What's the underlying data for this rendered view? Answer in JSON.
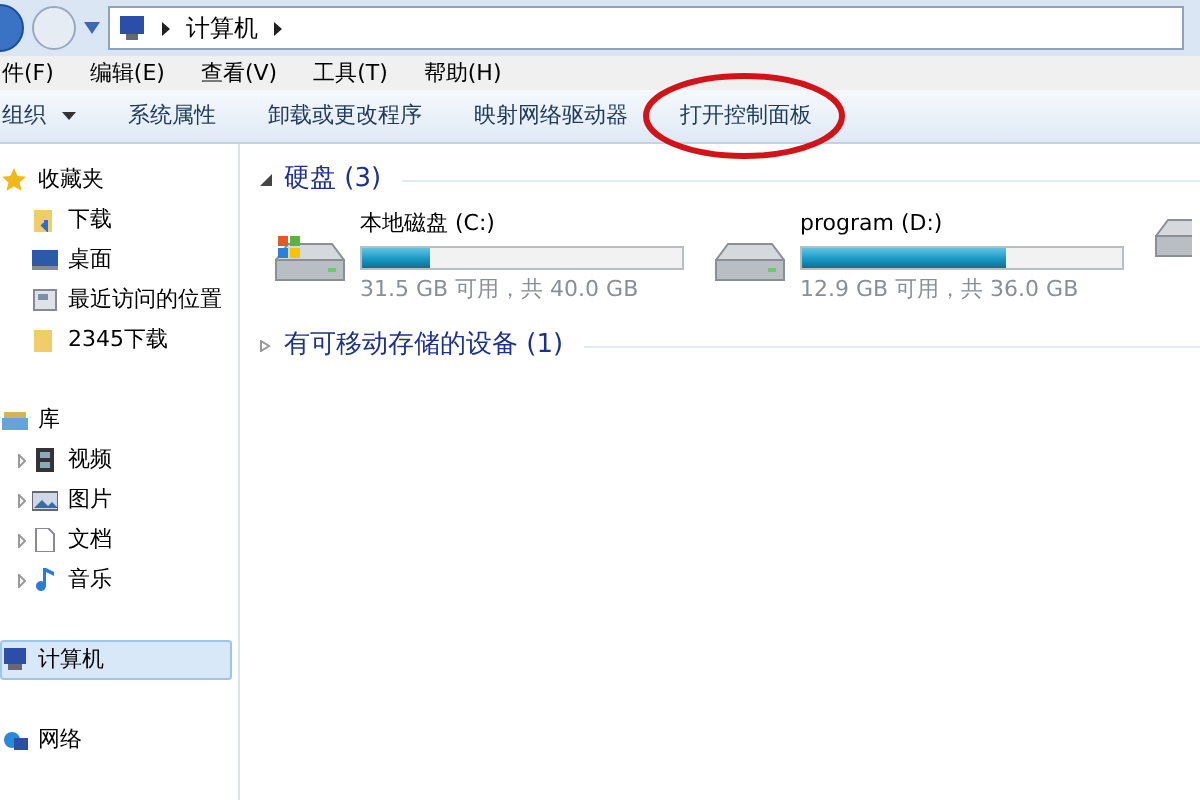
{
  "address_bar": {
    "path": [
      "计算机"
    ]
  },
  "menu": [
    {
      "label": "件(F)"
    },
    {
      "label": "编辑(E)"
    },
    {
      "label": "查看(V)"
    },
    {
      "label": "工具(T)"
    },
    {
      "label": "帮助(H)"
    }
  ],
  "toolbar": [
    {
      "label": "组织",
      "dropdown": true
    },
    {
      "label": "系统属性",
      "dropdown": false
    },
    {
      "label": "卸载或更改程序",
      "dropdown": false
    },
    {
      "label": "映射网络驱动器",
      "dropdown": false
    },
    {
      "label": "打开控制面板",
      "dropdown": false,
      "circled": true
    }
  ],
  "sidebar": {
    "groups": [
      {
        "label": "收藏夹",
        "selected": false,
        "children": [
          {
            "label": "下载",
            "selected": false
          },
          {
            "label": "桌面",
            "selected": false
          },
          {
            "label": "最近访问的位置",
            "selected": false
          },
          {
            "label": "2345下载",
            "selected": false
          }
        ]
      },
      {
        "label": "库",
        "selected": false,
        "children": [
          {
            "label": "视频",
            "selected": false
          },
          {
            "label": "图片",
            "selected": false
          },
          {
            "label": "文档",
            "selected": false
          },
          {
            "label": "音乐",
            "selected": false
          }
        ]
      },
      {
        "label": "计算机",
        "selected": true
      },
      {
        "label": "网络",
        "selected": false
      }
    ]
  },
  "sections": [
    {
      "title": "硬盘 (3)",
      "expanded": true,
      "drives": [
        {
          "name": "本地磁盘 (C:)",
          "level": 0.21,
          "space": "31.5 GB 可用，共 40.0 GB",
          "system": true
        },
        {
          "name": "program (D:)",
          "level": 0.64,
          "space": "12.9 GB 可用，共 36.0 GB",
          "system": false
        }
      ]
    },
    {
      "title": "有可移动存储的设备 (1)",
      "expanded": false
    }
  ]
}
